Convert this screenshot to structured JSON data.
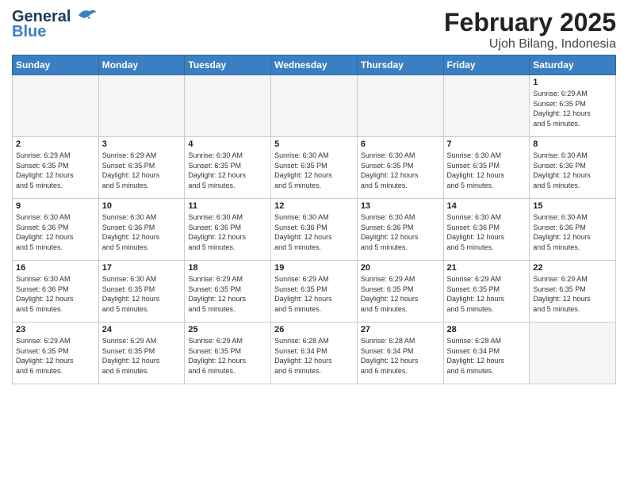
{
  "logo": {
    "line1": "General",
    "line2": "Blue"
  },
  "title": "February 2025",
  "subtitle": "Ujoh Bilang, Indonesia",
  "days_of_week": [
    "Sunday",
    "Monday",
    "Tuesday",
    "Wednesday",
    "Thursday",
    "Friday",
    "Saturday"
  ],
  "weeks": [
    [
      {
        "day": "",
        "info": ""
      },
      {
        "day": "",
        "info": ""
      },
      {
        "day": "",
        "info": ""
      },
      {
        "day": "",
        "info": ""
      },
      {
        "day": "",
        "info": ""
      },
      {
        "day": "",
        "info": ""
      },
      {
        "day": "1",
        "info": "Sunrise: 6:29 AM\nSunset: 6:35 PM\nDaylight: 12 hours\nand 5 minutes."
      }
    ],
    [
      {
        "day": "2",
        "info": "Sunrise: 6:29 AM\nSunset: 6:35 PM\nDaylight: 12 hours\nand 5 minutes."
      },
      {
        "day": "3",
        "info": "Sunrise: 6:29 AM\nSunset: 6:35 PM\nDaylight: 12 hours\nand 5 minutes."
      },
      {
        "day": "4",
        "info": "Sunrise: 6:30 AM\nSunset: 6:35 PM\nDaylight: 12 hours\nand 5 minutes."
      },
      {
        "day": "5",
        "info": "Sunrise: 6:30 AM\nSunset: 6:35 PM\nDaylight: 12 hours\nand 5 minutes."
      },
      {
        "day": "6",
        "info": "Sunrise: 6:30 AM\nSunset: 6:35 PM\nDaylight: 12 hours\nand 5 minutes."
      },
      {
        "day": "7",
        "info": "Sunrise: 6:30 AM\nSunset: 6:35 PM\nDaylight: 12 hours\nand 5 minutes."
      },
      {
        "day": "8",
        "info": "Sunrise: 6:30 AM\nSunset: 6:36 PM\nDaylight: 12 hours\nand 5 minutes."
      }
    ],
    [
      {
        "day": "9",
        "info": "Sunrise: 6:30 AM\nSunset: 6:36 PM\nDaylight: 12 hours\nand 5 minutes."
      },
      {
        "day": "10",
        "info": "Sunrise: 6:30 AM\nSunset: 6:36 PM\nDaylight: 12 hours\nand 5 minutes."
      },
      {
        "day": "11",
        "info": "Sunrise: 6:30 AM\nSunset: 6:36 PM\nDaylight: 12 hours\nand 5 minutes."
      },
      {
        "day": "12",
        "info": "Sunrise: 6:30 AM\nSunset: 6:36 PM\nDaylight: 12 hours\nand 5 minutes."
      },
      {
        "day": "13",
        "info": "Sunrise: 6:30 AM\nSunset: 6:36 PM\nDaylight: 12 hours\nand 5 minutes."
      },
      {
        "day": "14",
        "info": "Sunrise: 6:30 AM\nSunset: 6:36 PM\nDaylight: 12 hours\nand 5 minutes."
      },
      {
        "day": "15",
        "info": "Sunrise: 6:30 AM\nSunset: 6:36 PM\nDaylight: 12 hours\nand 5 minutes."
      }
    ],
    [
      {
        "day": "16",
        "info": "Sunrise: 6:30 AM\nSunset: 6:36 PM\nDaylight: 12 hours\nand 5 minutes."
      },
      {
        "day": "17",
        "info": "Sunrise: 6:30 AM\nSunset: 6:35 PM\nDaylight: 12 hours\nand 5 minutes."
      },
      {
        "day": "18",
        "info": "Sunrise: 6:29 AM\nSunset: 6:35 PM\nDaylight: 12 hours\nand 5 minutes."
      },
      {
        "day": "19",
        "info": "Sunrise: 6:29 AM\nSunset: 6:35 PM\nDaylight: 12 hours\nand 5 minutes."
      },
      {
        "day": "20",
        "info": "Sunrise: 6:29 AM\nSunset: 6:35 PM\nDaylight: 12 hours\nand 5 minutes."
      },
      {
        "day": "21",
        "info": "Sunrise: 6:29 AM\nSunset: 6:35 PM\nDaylight: 12 hours\nand 5 minutes."
      },
      {
        "day": "22",
        "info": "Sunrise: 6:29 AM\nSunset: 6:35 PM\nDaylight: 12 hours\nand 5 minutes."
      }
    ],
    [
      {
        "day": "23",
        "info": "Sunrise: 6:29 AM\nSunset: 6:35 PM\nDaylight: 12 hours\nand 6 minutes."
      },
      {
        "day": "24",
        "info": "Sunrise: 6:29 AM\nSunset: 6:35 PM\nDaylight: 12 hours\nand 6 minutes."
      },
      {
        "day": "25",
        "info": "Sunrise: 6:29 AM\nSunset: 6:35 PM\nDaylight: 12 hours\nand 6 minutes."
      },
      {
        "day": "26",
        "info": "Sunrise: 6:28 AM\nSunset: 6:34 PM\nDaylight: 12 hours\nand 6 minutes."
      },
      {
        "day": "27",
        "info": "Sunrise: 6:28 AM\nSunset: 6:34 PM\nDaylight: 12 hours\nand 6 minutes."
      },
      {
        "day": "28",
        "info": "Sunrise: 6:28 AM\nSunset: 6:34 PM\nDaylight: 12 hours\nand 6 minutes."
      },
      {
        "day": "",
        "info": ""
      }
    ]
  ]
}
